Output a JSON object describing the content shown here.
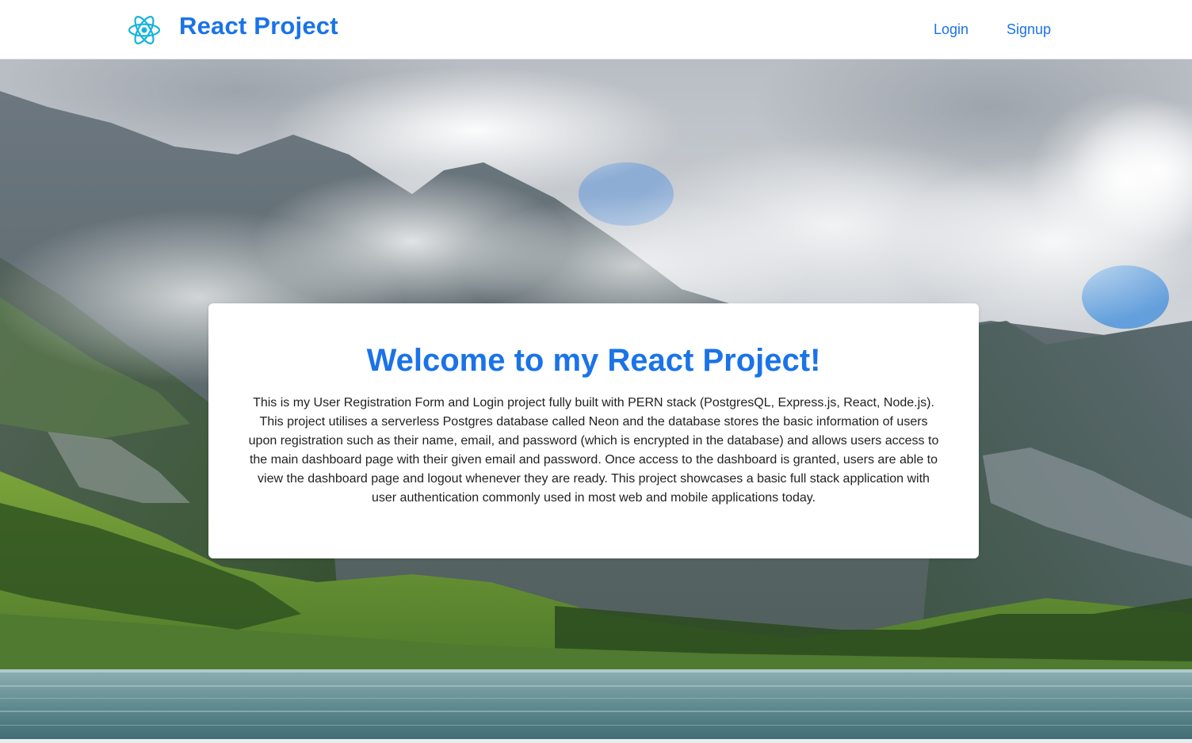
{
  "navbar": {
    "logo_icon": "react-atom-icon",
    "brand": "React Project",
    "links": [
      {
        "label": "Login"
      },
      {
        "label": "Signup"
      }
    ]
  },
  "hero": {
    "background": "mountain-lake-landscape-photo"
  },
  "welcome": {
    "title": "Welcome to my React Project!",
    "description": "This is my User Registration Form and Login project fully built with PERN stack (PostgresQL, Express.js, React, Node.js). This project utilises a serverless Postgres database called Neon and the database stores the basic information of users upon registration such as their name, email, and password (which is encrypted in the database) and allows users access to the main dashboard page with their given email and password. Once access to the dashboard is granted, users are able to view the dashboard page and logout whenever they are ready. This project showcases a basic full stack application with user authentication commonly used in most web and mobile applications today."
  },
  "colors": {
    "accent": "#1a73e8",
    "react_logo": "#16b3dc",
    "card_bg": "#ffffff",
    "body_text": "#222222"
  }
}
